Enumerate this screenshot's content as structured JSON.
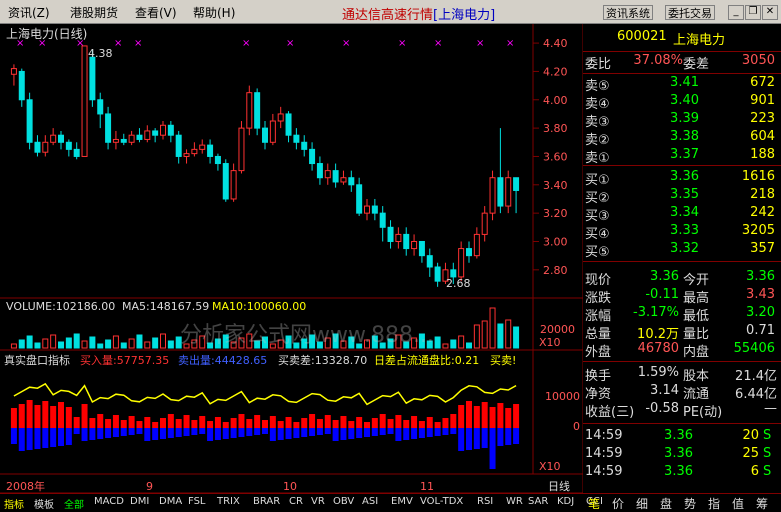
{
  "menu": {
    "items": [
      "资讯(Z)",
      "港股期货",
      "查看(V)",
      "帮助(H)"
    ],
    "title_prefix": "通达信高速行情",
    "title_stock": "[上海电力]",
    "btn_info": "资讯系统",
    "btn_trade": "委托交易"
  },
  "chart": {
    "title": "上海电力(日线)",
    "high_label": "4.38",
    "low_label": "2.68",
    "price_ticks": [
      "4.40",
      "4.20",
      "4.00",
      "3.80",
      "3.60",
      "3.40",
      "3.20",
      "3.00",
      "2.80"
    ],
    "volume_text": "VOLUME:102186.00",
    "ma5_text": "MA5:148167.59",
    "ma10_text": "MA10:100060.00",
    "vol_ticks": [
      "20000",
      "X10"
    ],
    "ind_name": "真实盘口指标",
    "buy_text": "买入量:57757.35",
    "sell_text": "卖出量:44428.65",
    "diff_text": "买卖差:13328.70",
    "ratio_text": "日差占流通盘比:0.21",
    "buysell_text": "买卖!",
    "ind_ticks": [
      "10000",
      "0",
      "X10"
    ],
    "watermark": "分析家公式网www.888...",
    "date_labels": [
      "2008年",
      "9",
      "10",
      "11"
    ],
    "period": "日线",
    "colors": {
      "up": "#ff3232",
      "down": "#00e0e0",
      "grid": "#800000",
      "ma": "#ffff00",
      "buy": "#ff0000",
      "sell": "#0000ff",
      "label_red": "#ff5555"
    }
  },
  "chart_data": {
    "type": "candlestick",
    "price_range": [
      2.68,
      4.38
    ],
    "candles": [
      [
        4.18,
        4.22,
        4.1,
        4.25
      ],
      [
        4.2,
        4.0,
        3.95,
        4.22
      ],
      [
        4.0,
        3.7,
        3.65,
        4.05
      ],
      [
        3.7,
        3.63,
        3.6,
        3.75
      ],
      [
        3.63,
        3.7,
        3.6,
        3.75
      ],
      [
        3.7,
        3.75,
        3.68,
        3.8
      ],
      [
        3.75,
        3.7,
        3.65,
        3.78
      ],
      [
        3.7,
        3.65,
        3.6,
        3.72
      ],
      [
        3.65,
        3.6,
        3.58,
        3.7
      ],
      [
        3.6,
        4.38,
        3.6,
        4.38
      ],
      [
        4.3,
        4.0,
        3.95,
        4.35
      ],
      [
        4.0,
        3.9,
        3.8,
        4.05
      ],
      [
        3.9,
        3.7,
        3.65,
        3.95
      ],
      [
        3.7,
        3.72,
        3.65,
        3.78
      ],
      [
        3.72,
        3.7,
        3.68,
        3.76
      ],
      [
        3.7,
        3.75,
        3.68,
        3.78
      ],
      [
        3.75,
        3.72,
        3.7,
        3.8
      ],
      [
        3.72,
        3.78,
        3.7,
        3.82
      ],
      [
        3.78,
        3.75,
        3.7,
        3.8
      ],
      [
        3.75,
        3.82,
        3.72,
        3.85
      ],
      [
        3.82,
        3.75,
        3.7,
        3.85
      ],
      [
        3.75,
        3.6,
        3.55,
        3.78
      ],
      [
        3.6,
        3.62,
        3.55,
        3.65
      ],
      [
        3.62,
        3.65,
        3.6,
        3.7
      ],
      [
        3.65,
        3.68,
        3.62,
        3.72
      ],
      [
        3.68,
        3.6,
        3.55,
        3.72
      ],
      [
        3.6,
        3.55,
        3.5,
        3.62
      ],
      [
        3.55,
        3.3,
        3.28,
        3.58
      ],
      [
        3.3,
        3.5,
        3.28,
        3.55
      ],
      [
        3.5,
        3.8,
        3.48,
        3.85
      ],
      [
        3.8,
        4.05,
        3.75,
        4.1
      ],
      [
        4.05,
        3.8,
        3.75,
        4.08
      ],
      [
        3.8,
        3.7,
        3.65,
        3.85
      ],
      [
        3.7,
        3.85,
        3.68,
        3.9
      ],
      [
        3.85,
        3.9,
        3.8,
        3.95
      ],
      [
        3.9,
        3.75,
        3.7,
        3.92
      ],
      [
        3.75,
        3.7,
        3.65,
        3.8
      ],
      [
        3.7,
        3.65,
        3.6,
        3.75
      ],
      [
        3.65,
        3.55,
        3.5,
        3.7
      ],
      [
        3.55,
        3.45,
        3.4,
        3.6
      ],
      [
        3.45,
        3.5,
        3.4,
        3.55
      ],
      [
        3.5,
        3.42,
        3.38,
        3.55
      ],
      [
        3.42,
        3.45,
        3.4,
        3.5
      ],
      [
        3.45,
        3.4,
        3.35,
        3.5
      ],
      [
        3.4,
        3.2,
        3.18,
        3.45
      ],
      [
        3.2,
        3.25,
        3.15,
        3.3
      ],
      [
        3.25,
        3.2,
        3.15,
        3.3
      ],
      [
        3.2,
        3.1,
        3.0,
        3.25
      ],
      [
        3.1,
        3.0,
        2.95,
        3.15
      ],
      [
        3.0,
        3.05,
        2.95,
        3.1
      ],
      [
        3.05,
        2.95,
        2.9,
        3.1
      ],
      [
        2.95,
        3.0,
        2.9,
        3.05
      ],
      [
        3.0,
        2.9,
        2.85,
        3.0
      ],
      [
        2.9,
        2.82,
        2.75,
        2.95
      ],
      [
        2.82,
        2.72,
        2.68,
        2.85
      ],
      [
        2.72,
        2.8,
        2.7,
        2.85
      ],
      [
        2.8,
        2.75,
        2.7,
        2.85
      ],
      [
        2.75,
        2.95,
        2.72,
        3.0
      ],
      [
        2.95,
        2.9,
        2.85,
        3.0
      ],
      [
        2.9,
        3.05,
        2.88,
        3.1
      ],
      [
        3.05,
        3.2,
        3.0,
        3.25
      ],
      [
        3.2,
        3.45,
        3.15,
        3.5
      ],
      [
        3.45,
        3.25,
        3.2,
        3.8
      ],
      [
        3.25,
        3.45,
        3.2,
        3.5
      ],
      [
        3.45,
        3.36,
        3.2,
        3.43
      ]
    ]
  },
  "quote": {
    "code": "600021",
    "name": "上海电力",
    "weibi_label": "委比",
    "weibi": "37.08%",
    "weicha_label": "委差",
    "weicha": "3050",
    "sell": [
      {
        "label": "卖⑤",
        "price": "3.41",
        "vol": "672"
      },
      {
        "label": "卖④",
        "price": "3.40",
        "vol": "901"
      },
      {
        "label": "卖③",
        "price": "3.39",
        "vol": "223"
      },
      {
        "label": "卖②",
        "price": "3.38",
        "vol": "604"
      },
      {
        "label": "卖①",
        "price": "3.37",
        "vol": "188"
      }
    ],
    "buy": [
      {
        "label": "买①",
        "price": "3.36",
        "vol": "1616"
      },
      {
        "label": "买②",
        "price": "3.35",
        "vol": "218"
      },
      {
        "label": "买③",
        "price": "3.34",
        "vol": "242"
      },
      {
        "label": "买④",
        "price": "3.33",
        "vol": "3205"
      },
      {
        "label": "买⑤",
        "price": "3.32",
        "vol": "357"
      }
    ],
    "stats": [
      {
        "l1": "现价",
        "v1": "3.36",
        "l2": "今开",
        "v2": "3.36",
        "c1": "#00ff00",
        "c2": "#00ff00"
      },
      {
        "l1": "涨跌",
        "v1": "-0.11",
        "l2": "最高",
        "v2": "3.43",
        "c1": "#00ff00",
        "c2": "#ff5555"
      },
      {
        "l1": "涨幅",
        "v1": "-3.17%",
        "l2": "最低",
        "v2": "3.20",
        "c1": "#00ff00",
        "c2": "#00ff00"
      },
      {
        "l1": "总量",
        "v1": "10.2万",
        "l2": "量比",
        "v2": "0.71",
        "c1": "#ffff00",
        "c2": "#dcdcdc"
      },
      {
        "l1": "外盘",
        "v1": "46780",
        "l2": "内盘",
        "v2": "55406",
        "c1": "#ff5555",
        "c2": "#00ff00"
      }
    ],
    "stats2": [
      {
        "l1": "换手",
        "v1": "1.59%",
        "l2": "股本",
        "v2": "21.4亿"
      },
      {
        "l1": "净资",
        "v1": "3.14",
        "l2": "流通",
        "v2": "6.44亿"
      },
      {
        "l1": "收益(三)",
        "v1": "-0.58",
        "l2": "PE(动)",
        "v2": "—"
      }
    ],
    "ticks": [
      {
        "time": "14:59",
        "price": "3.36",
        "vol": "20",
        "dir": "S"
      },
      {
        "time": "14:59",
        "price": "3.36",
        "vol": "25",
        "dir": "S"
      },
      {
        "time": "14:59",
        "price": "3.36",
        "vol": "6",
        "dir": "S"
      }
    ]
  },
  "tabs": [
    "指标",
    "模板",
    "全部",
    "MACD",
    "DMI",
    "DMA",
    "FSL",
    "TRIX",
    "BRAR",
    "CR",
    "VR",
    "OBV",
    "ASI",
    "EMV",
    "VOL-TDX",
    "RSI",
    "WR",
    "SAR",
    "KDJ",
    "CCI"
  ],
  "right_tabs": [
    "笔",
    "价",
    "细",
    "盘",
    "势",
    "指",
    "值",
    "筹"
  ]
}
